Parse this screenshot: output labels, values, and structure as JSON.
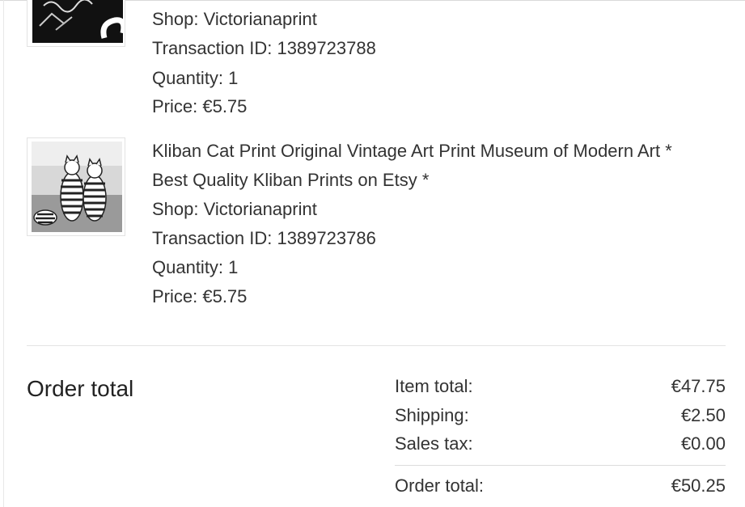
{
  "items": [
    {
      "image_icon": "artwork-thumbnail-icon",
      "title_lines": [],
      "shop": "Shop: Victorianaprint",
      "transaction": "Transaction ID: 1389723788",
      "quantity": "Quantity: 1",
      "price": "Price: €5.75"
    },
    {
      "image_icon": "cat-print-thumbnail-icon",
      "title_lines": [
        "Kliban Cat Print Original Vintage Art Print Museum of Modern Art *",
        "Best Quality Kliban Prints on Etsy *"
      ],
      "shop": "Shop: Victorianaprint",
      "transaction": "Transaction ID: 1389723786",
      "quantity": "Quantity: 1",
      "price": "Price: €5.75"
    }
  ],
  "order_summary": {
    "heading": "Order total",
    "rows": [
      {
        "label": "Item total:",
        "value": "€47.75"
      },
      {
        "label": "Shipping:",
        "value": "€2.50"
      },
      {
        "label": "Sales tax:",
        "value": "€0.00"
      }
    ],
    "total": {
      "label": "Order total:",
      "value": "€50.25"
    }
  }
}
